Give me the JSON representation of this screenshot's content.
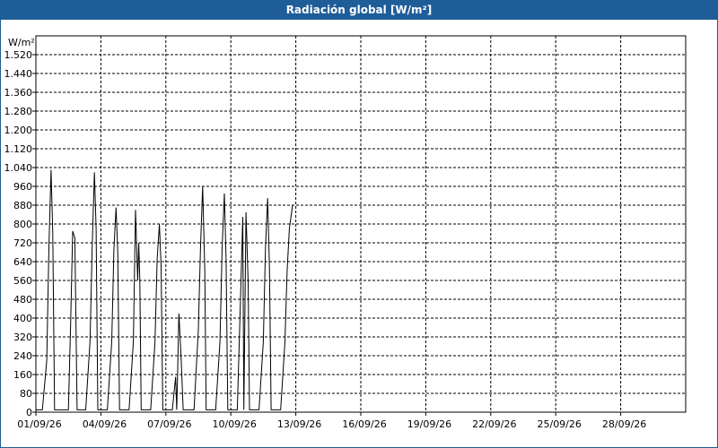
{
  "window": {
    "title": "Radiación global [W/m²]"
  },
  "chart_data": {
    "type": "line",
    "title": "Radiación global [W/m²]",
    "ylabel": "W/m²",
    "xlabel": "",
    "ylim": [
      0,
      1600
    ],
    "xlim": [
      0,
      30
    ],
    "grid": true,
    "yticks": [
      0,
      80,
      160,
      240,
      320,
      400,
      480,
      560,
      640,
      720,
      800,
      880,
      960,
      1040,
      1120,
      1200,
      1280,
      1360,
      1440,
      1520
    ],
    "ytick_labels": [
      "0",
      "80",
      "160",
      "240",
      "320",
      "400",
      "480",
      "560",
      "640",
      "720",
      "800",
      "880",
      "960",
      "1.040",
      "1.120",
      "1.200",
      "1.280",
      "1.360",
      "1.440",
      "1.520"
    ],
    "xticks": [
      0,
      3,
      6,
      9,
      12,
      15,
      18,
      21,
      24,
      27
    ],
    "xtick_labels": [
      "01/09/26",
      "04/09/26",
      "07/09/26",
      "10/09/26",
      "13/09/26",
      "16/09/26",
      "19/09/26",
      "22/09/26",
      "25/09/26",
      "28/09/26"
    ],
    "series_color": "#000000",
    "series": [
      {
        "x": [
          0,
          0.3,
          0.5,
          0.6,
          0.7,
          0.78,
          0.86,
          1.0,
          1.3,
          1.5,
          1.6,
          1.7,
          1.8,
          1.9,
          2.0,
          2.3,
          2.5,
          2.6,
          2.7,
          2.78,
          2.86,
          3.0,
          3.3,
          3.5,
          3.6,
          3.7,
          3.78,
          3.86,
          4.0,
          4.3,
          4.5,
          4.6,
          4.7,
          4.75,
          4.8,
          4.86,
          5.0,
          5.3,
          5.5,
          5.6,
          5.7,
          5.78,
          5.86,
          6.0,
          6.3,
          6.45,
          6.5,
          6.55,
          6.6,
          6.7,
          6.8,
          6.9,
          7.0,
          7.3,
          7.5,
          7.6,
          7.7,
          7.8,
          7.86,
          8.0,
          8.3,
          8.5,
          8.6,
          8.7,
          8.78,
          8.86,
          9.0,
          9.3,
          9.45,
          9.55,
          9.6,
          9.7,
          9.8,
          9.86,
          10.0,
          10.3,
          10.5,
          10.6,
          10.7,
          10.78,
          10.86,
          11.0,
          11.3,
          11.5,
          11.6,
          11.7,
          11.85
        ],
        "y": [
          10,
          10,
          220,
          700,
          1030,
          760,
          10,
          10,
          10,
          10,
          360,
          770,
          740,
          10,
          10,
          10,
          300,
          700,
          1020,
          780,
          10,
          10,
          10,
          300,
          690,
          870,
          680,
          10,
          10,
          10,
          300,
          860,
          560,
          720,
          560,
          10,
          10,
          10,
          300,
          650,
          800,
          620,
          10,
          10,
          10,
          150,
          10,
          200,
          420,
          240,
          10,
          10,
          10,
          10,
          350,
          700,
          960,
          600,
          10,
          10,
          10,
          300,
          700,
          930,
          650,
          10,
          10,
          10,
          500,
          830,
          10,
          850,
          550,
          10,
          10,
          10,
          300,
          700,
          910,
          620,
          10,
          10,
          10,
          300,
          600,
          780,
          880
        ]
      }
    ]
  }
}
